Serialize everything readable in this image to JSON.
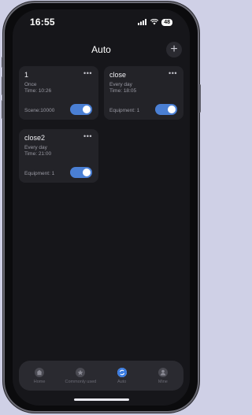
{
  "status": {
    "time": "16:55",
    "battery": "48"
  },
  "header": {
    "title": "Auto",
    "add_label": "+"
  },
  "cards": [
    {
      "name": "1",
      "schedule": "Once",
      "time": "Time: 10:26",
      "detail": "Scene:10000",
      "enabled": true
    },
    {
      "name": "close",
      "schedule": "Every day",
      "time": "Time: 18:05",
      "detail": "Equipment: 1",
      "enabled": true
    },
    {
      "name": "close2",
      "schedule": "Every day",
      "time": "Time: 21:00",
      "detail": "Equipment: 1",
      "enabled": true
    }
  ],
  "more_label": "•••",
  "tabs": [
    {
      "label": "Home",
      "icon": "home-icon",
      "active": false
    },
    {
      "label": "Commonly used",
      "icon": "star-icon",
      "active": false
    },
    {
      "label": "Auto",
      "icon": "auto-icon",
      "active": true
    },
    {
      "label": "Mine",
      "icon": "user-icon",
      "active": false
    }
  ],
  "colors": {
    "accent": "#4a7fd4",
    "card": "#232328",
    "background": "#16161a"
  }
}
